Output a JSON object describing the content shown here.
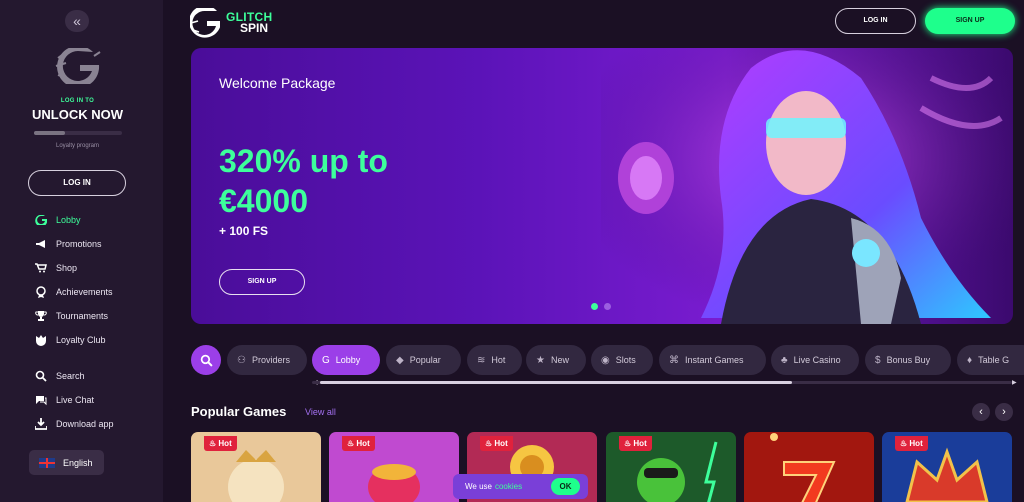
{
  "sidebar": {
    "collapse_icon": "«",
    "unlock_small": "LOG IN TO",
    "unlock_title": "UNLOCK NOW",
    "loyalty_progress": 0.35,
    "loyalty_label": "Loyalty program",
    "login_label": "LOG IN",
    "nav": [
      {
        "label": "Lobby",
        "icon": "glitch-logo-icon",
        "active": true
      },
      {
        "label": "Promotions",
        "icon": "megaphone-icon"
      },
      {
        "label": "Shop",
        "icon": "cart-icon"
      },
      {
        "label": "Achievements",
        "icon": "medal-icon"
      },
      {
        "label": "Tournaments",
        "icon": "trophy-icon"
      },
      {
        "label": "Loyalty Club",
        "icon": "crown-shield-icon"
      }
    ],
    "nav2": [
      {
        "label": "Search",
        "icon": "search-icon"
      },
      {
        "label": "Live Chat",
        "icon": "chat-icon"
      },
      {
        "label": "Download app",
        "icon": "download-icon"
      }
    ],
    "language": "English"
  },
  "header": {
    "brand_line1": "GLITCH",
    "brand_line2": "SPIN",
    "login_label": "LOG IN",
    "signup_label": "SIGN UP"
  },
  "banner": {
    "title": "Welcome Package",
    "offer": "320% up to €4000",
    "extra": "+ 100 FS",
    "signup_label": "SIGN UP",
    "slides": 2,
    "active_slide": 1
  },
  "tabs": [
    {
      "label": "Providers",
      "icon": "providers-icon"
    },
    {
      "label": "Lobby",
      "icon": "glitch-logo-icon",
      "active": true
    },
    {
      "label": "Popular",
      "icon": "flame-icon"
    },
    {
      "label": "Hot",
      "icon": "heat-icon"
    },
    {
      "label": "New",
      "icon": "star-icon"
    },
    {
      "label": "Slots",
      "icon": "eye-icon"
    },
    {
      "label": "Instant Games",
      "icon": "gamepad-icon"
    },
    {
      "label": "Live Casino",
      "icon": "cards-icon"
    },
    {
      "label": "Bonus Buy",
      "icon": "moneybag-icon"
    },
    {
      "label": "Table G",
      "icon": "table-icon"
    }
  ],
  "popular": {
    "title": "Popular Games",
    "view_all": "View all",
    "games": [
      {
        "badge": "Hot",
        "color": "#e9c89a"
      },
      {
        "badge": "Hot",
        "color": "#c04ad0"
      },
      {
        "badge": "Hot",
        "color": "#b22a55"
      },
      {
        "badge": "Hot",
        "color": "#1d5a2a"
      },
      {
        "badge": "",
        "color": "#a2170f"
      },
      {
        "badge": "Hot",
        "color": "#1a3d9a"
      }
    ]
  },
  "cookie": {
    "text": "We use",
    "link": "cookies",
    "ok": "OK"
  },
  "colors": {
    "accent_green": "#1eff8c",
    "accent_purple": "#9b3fe8",
    "hot_badge": "#e0223c"
  }
}
